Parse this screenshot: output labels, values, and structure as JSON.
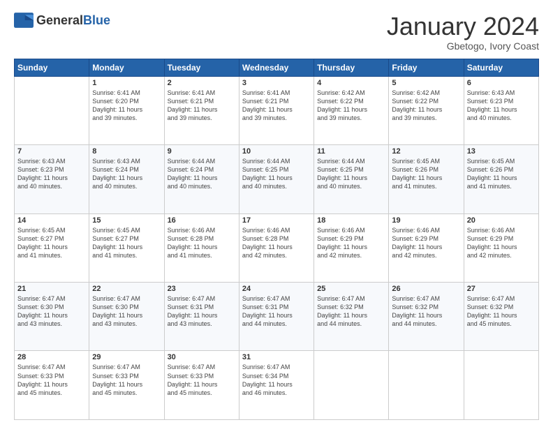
{
  "header": {
    "logo_general": "General",
    "logo_blue": "Blue",
    "title": "January 2024",
    "subtitle": "Gbetogo, Ivory Coast"
  },
  "weekdays": [
    "Sunday",
    "Monday",
    "Tuesday",
    "Wednesday",
    "Thursday",
    "Friday",
    "Saturday"
  ],
  "weeks": [
    [
      {
        "day": "",
        "info": ""
      },
      {
        "day": "1",
        "info": "Sunrise: 6:41 AM\nSunset: 6:20 PM\nDaylight: 11 hours\nand 39 minutes."
      },
      {
        "day": "2",
        "info": "Sunrise: 6:41 AM\nSunset: 6:21 PM\nDaylight: 11 hours\nand 39 minutes."
      },
      {
        "day": "3",
        "info": "Sunrise: 6:41 AM\nSunset: 6:21 PM\nDaylight: 11 hours\nand 39 minutes."
      },
      {
        "day": "4",
        "info": "Sunrise: 6:42 AM\nSunset: 6:22 PM\nDaylight: 11 hours\nand 39 minutes."
      },
      {
        "day": "5",
        "info": "Sunrise: 6:42 AM\nSunset: 6:22 PM\nDaylight: 11 hours\nand 39 minutes."
      },
      {
        "day": "6",
        "info": "Sunrise: 6:43 AM\nSunset: 6:23 PM\nDaylight: 11 hours\nand 40 minutes."
      }
    ],
    [
      {
        "day": "7",
        "info": "Sunrise: 6:43 AM\nSunset: 6:23 PM\nDaylight: 11 hours\nand 40 minutes."
      },
      {
        "day": "8",
        "info": "Sunrise: 6:43 AM\nSunset: 6:24 PM\nDaylight: 11 hours\nand 40 minutes."
      },
      {
        "day": "9",
        "info": "Sunrise: 6:44 AM\nSunset: 6:24 PM\nDaylight: 11 hours\nand 40 minutes."
      },
      {
        "day": "10",
        "info": "Sunrise: 6:44 AM\nSunset: 6:25 PM\nDaylight: 11 hours\nand 40 minutes."
      },
      {
        "day": "11",
        "info": "Sunrise: 6:44 AM\nSunset: 6:25 PM\nDaylight: 11 hours\nand 40 minutes."
      },
      {
        "day": "12",
        "info": "Sunrise: 6:45 AM\nSunset: 6:26 PM\nDaylight: 11 hours\nand 41 minutes."
      },
      {
        "day": "13",
        "info": "Sunrise: 6:45 AM\nSunset: 6:26 PM\nDaylight: 11 hours\nand 41 minutes."
      }
    ],
    [
      {
        "day": "14",
        "info": "Sunrise: 6:45 AM\nSunset: 6:27 PM\nDaylight: 11 hours\nand 41 minutes."
      },
      {
        "day": "15",
        "info": "Sunrise: 6:45 AM\nSunset: 6:27 PM\nDaylight: 11 hours\nand 41 minutes."
      },
      {
        "day": "16",
        "info": "Sunrise: 6:46 AM\nSunset: 6:28 PM\nDaylight: 11 hours\nand 41 minutes."
      },
      {
        "day": "17",
        "info": "Sunrise: 6:46 AM\nSunset: 6:28 PM\nDaylight: 11 hours\nand 42 minutes."
      },
      {
        "day": "18",
        "info": "Sunrise: 6:46 AM\nSunset: 6:29 PM\nDaylight: 11 hours\nand 42 minutes."
      },
      {
        "day": "19",
        "info": "Sunrise: 6:46 AM\nSunset: 6:29 PM\nDaylight: 11 hours\nand 42 minutes."
      },
      {
        "day": "20",
        "info": "Sunrise: 6:46 AM\nSunset: 6:29 PM\nDaylight: 11 hours\nand 42 minutes."
      }
    ],
    [
      {
        "day": "21",
        "info": "Sunrise: 6:47 AM\nSunset: 6:30 PM\nDaylight: 11 hours\nand 43 minutes."
      },
      {
        "day": "22",
        "info": "Sunrise: 6:47 AM\nSunset: 6:30 PM\nDaylight: 11 hours\nand 43 minutes."
      },
      {
        "day": "23",
        "info": "Sunrise: 6:47 AM\nSunset: 6:31 PM\nDaylight: 11 hours\nand 43 minutes."
      },
      {
        "day": "24",
        "info": "Sunrise: 6:47 AM\nSunset: 6:31 PM\nDaylight: 11 hours\nand 44 minutes."
      },
      {
        "day": "25",
        "info": "Sunrise: 6:47 AM\nSunset: 6:32 PM\nDaylight: 11 hours\nand 44 minutes."
      },
      {
        "day": "26",
        "info": "Sunrise: 6:47 AM\nSunset: 6:32 PM\nDaylight: 11 hours\nand 44 minutes."
      },
      {
        "day": "27",
        "info": "Sunrise: 6:47 AM\nSunset: 6:32 PM\nDaylight: 11 hours\nand 45 minutes."
      }
    ],
    [
      {
        "day": "28",
        "info": "Sunrise: 6:47 AM\nSunset: 6:33 PM\nDaylight: 11 hours\nand 45 minutes."
      },
      {
        "day": "29",
        "info": "Sunrise: 6:47 AM\nSunset: 6:33 PM\nDaylight: 11 hours\nand 45 minutes."
      },
      {
        "day": "30",
        "info": "Sunrise: 6:47 AM\nSunset: 6:33 PM\nDaylight: 11 hours\nand 45 minutes."
      },
      {
        "day": "31",
        "info": "Sunrise: 6:47 AM\nSunset: 6:34 PM\nDaylight: 11 hours\nand 46 minutes."
      },
      {
        "day": "",
        "info": ""
      },
      {
        "day": "",
        "info": ""
      },
      {
        "day": "",
        "info": ""
      }
    ]
  ]
}
